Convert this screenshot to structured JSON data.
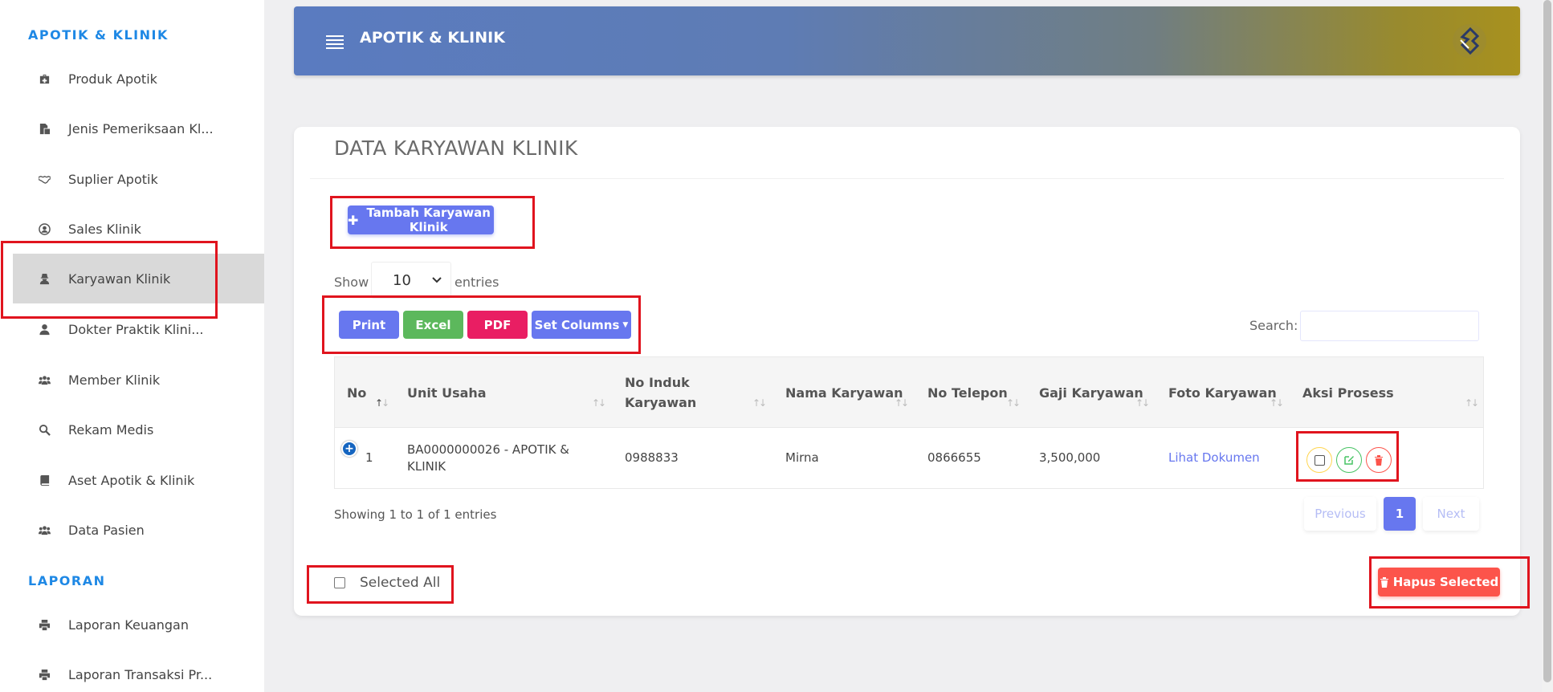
{
  "sidebar": {
    "section_main": "APOTIK & KLINIK",
    "items": [
      {
        "label": "Produk Apotik",
        "icon": "medkit-icon"
      },
      {
        "label": "Jenis Pemeriksaan Kl...",
        "icon": "copy-icon"
      },
      {
        "label": "Suplier Apotik",
        "icon": "handshake-icon"
      },
      {
        "label": "Sales Klinik",
        "icon": "user-circle-icon"
      },
      {
        "label": "Karyawan Klinik",
        "icon": "user-secret-icon",
        "active": true
      },
      {
        "label": "Dokter Praktik Klini...",
        "icon": "user-icon"
      },
      {
        "label": "Member Klinik",
        "icon": "users-icon"
      },
      {
        "label": "Rekam Medis",
        "icon": "search-icon"
      },
      {
        "label": "Aset Apotik & Klinik",
        "icon": "book-icon"
      },
      {
        "label": "Data Pasien",
        "icon": "users-icon"
      }
    ],
    "section_report": "LAPORAN",
    "report_items": [
      {
        "label": "Laporan Keuangan",
        "icon": "print-icon"
      },
      {
        "label": "Laporan Transaksi Pr...",
        "icon": "print-icon"
      }
    ]
  },
  "header": {
    "title": "APOTIK & KLINIK"
  },
  "card": {
    "title": "DATA KARYAWAN KLINIK",
    "add_button": "Tambah Karyawan Klinik",
    "show_label": "Show",
    "entries_value": "10",
    "entries_label": "entries",
    "export_buttons": {
      "print": "Print",
      "excel": "Excel",
      "pdf": "PDF",
      "columns": "Set Columns"
    },
    "search_label": "Search:",
    "search_value": ""
  },
  "table": {
    "headers": {
      "no": "No",
      "unit": "Unit Usaha",
      "induk_1": "No Induk",
      "induk_2": "Karyawan",
      "nama": "Nama Karyawan",
      "telepon": "No Telepon",
      "gaji": "Gaji Karyawan",
      "foto": "Foto Karyawan",
      "aksi": "Aksi Prosess"
    },
    "rows": [
      {
        "no": "1",
        "unit_1": "BA0000000026 - APOTIK &",
        "unit_2": "KLINIK",
        "induk": "0988833",
        "nama": "Mirna",
        "telepon": "0866655",
        "gaji": "3,500,000",
        "foto": "Lihat Dokumen"
      }
    ]
  },
  "footer": {
    "showing": "Showing 1 to 1 of 1 entries",
    "prev": "Previous",
    "page": "1",
    "next": "Next",
    "select_all": "Selected All",
    "delete_selected": "Hapus Selected"
  },
  "colors": {
    "primary": "#6777ef",
    "success": "#5cb85c",
    "danger": "#e91e63",
    "delete": "#fc544b",
    "accent_blue": "#1e88e5",
    "highlight": "#e0141e"
  }
}
